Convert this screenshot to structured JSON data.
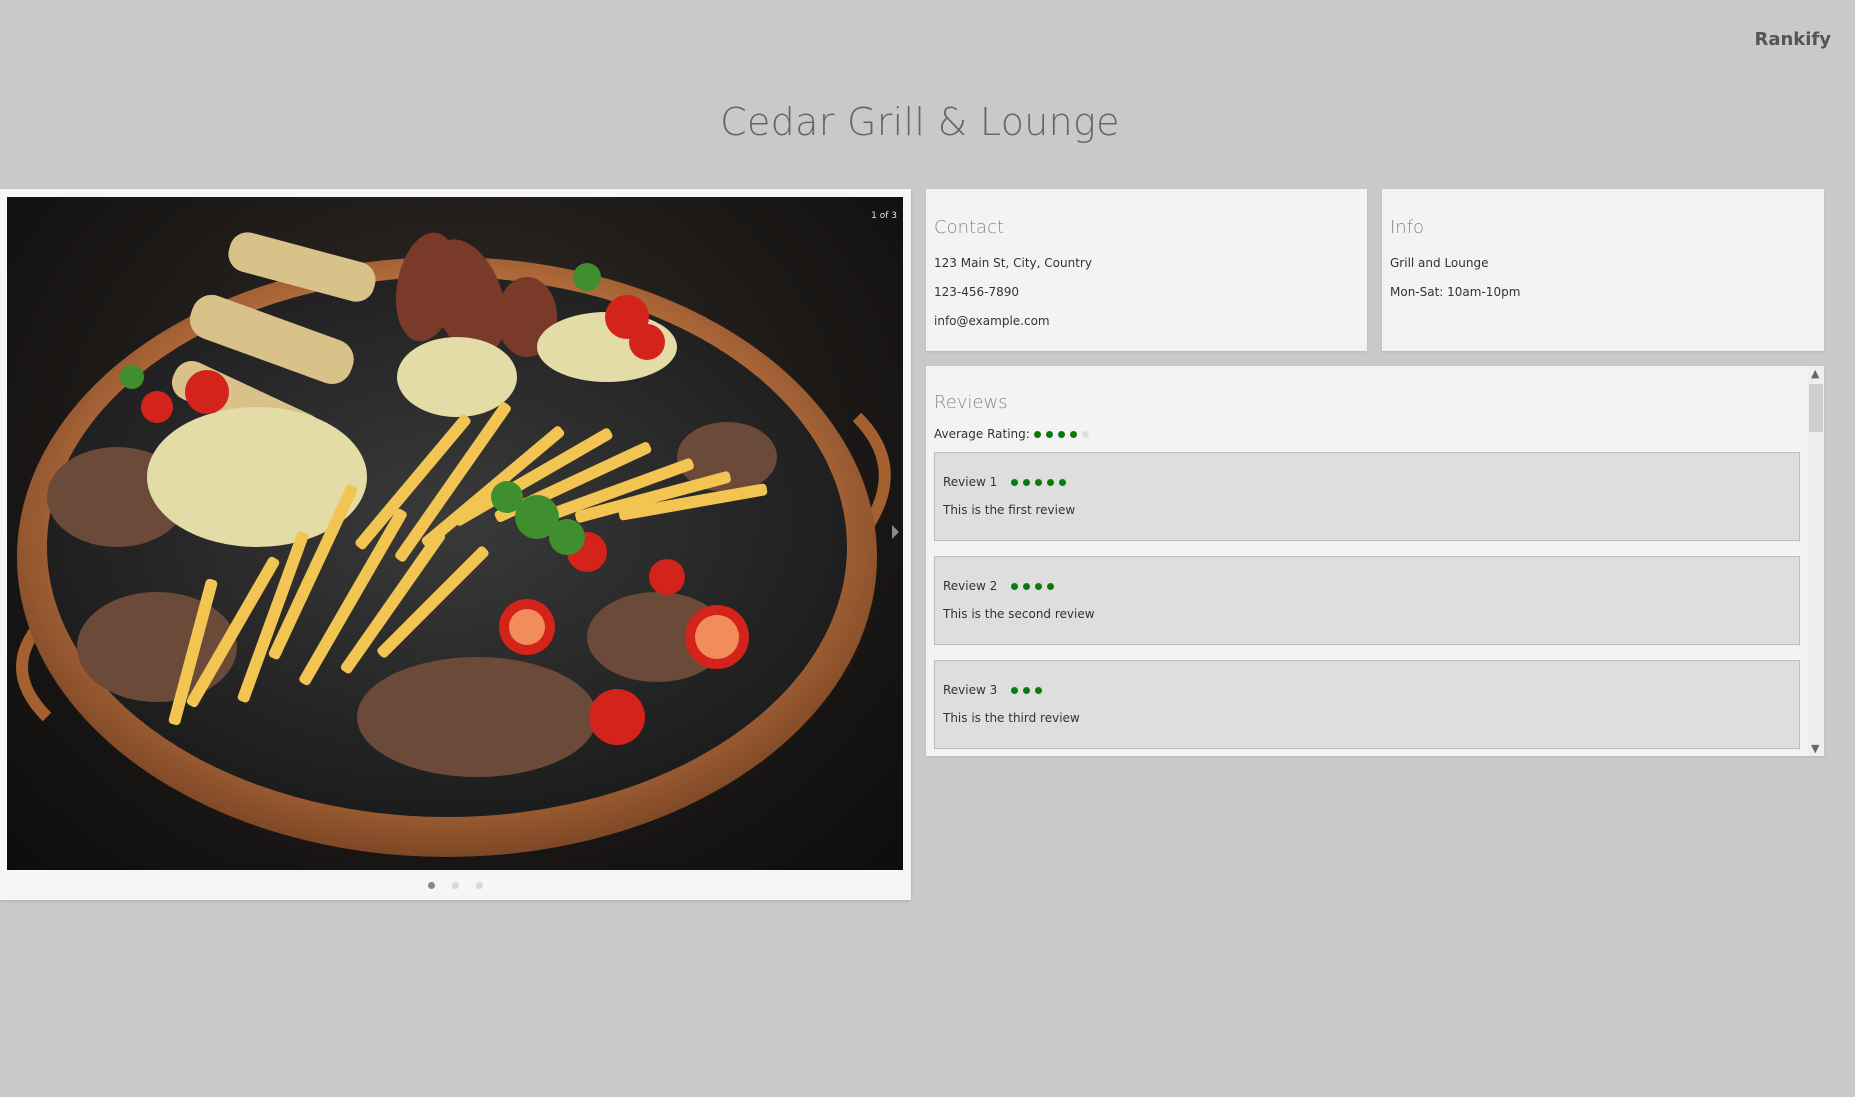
{
  "brand": "Rankify",
  "title": "Cedar Grill & Lounge",
  "carousel": {
    "counter": "1 of 3",
    "slides": 3,
    "active_slide": 1,
    "image_description": "grilled meat platter with fries, cheese and tomatoes"
  },
  "contact": {
    "heading": "Contact",
    "address": "123 Main St, City, Country",
    "phone": "123-456-7890",
    "email": "info@example.com"
  },
  "info": {
    "heading": "Info",
    "category": "Grill and Lounge",
    "hours": "Mon-Sat: 10am-10pm"
  },
  "reviews": {
    "heading": "Reviews",
    "average_label": "Average Rating:",
    "average_rating": 4,
    "max_rating": 5,
    "items": [
      {
        "title": "Review 1",
        "rating": 5,
        "text": "This is the first review"
      },
      {
        "title": "Review 2",
        "rating": 4,
        "text": "This is the second review"
      },
      {
        "title": "Review 3",
        "rating": 3,
        "text": "This is the third review"
      }
    ]
  },
  "colors": {
    "background": "#c9c9c9",
    "card": "#f3f3f3",
    "rating_on": "#0a7a0a",
    "rating_off": "#e0e0e0"
  },
  "icons": [
    "next-arrow-icon",
    "scroll-up-icon",
    "scroll-down-icon"
  ]
}
